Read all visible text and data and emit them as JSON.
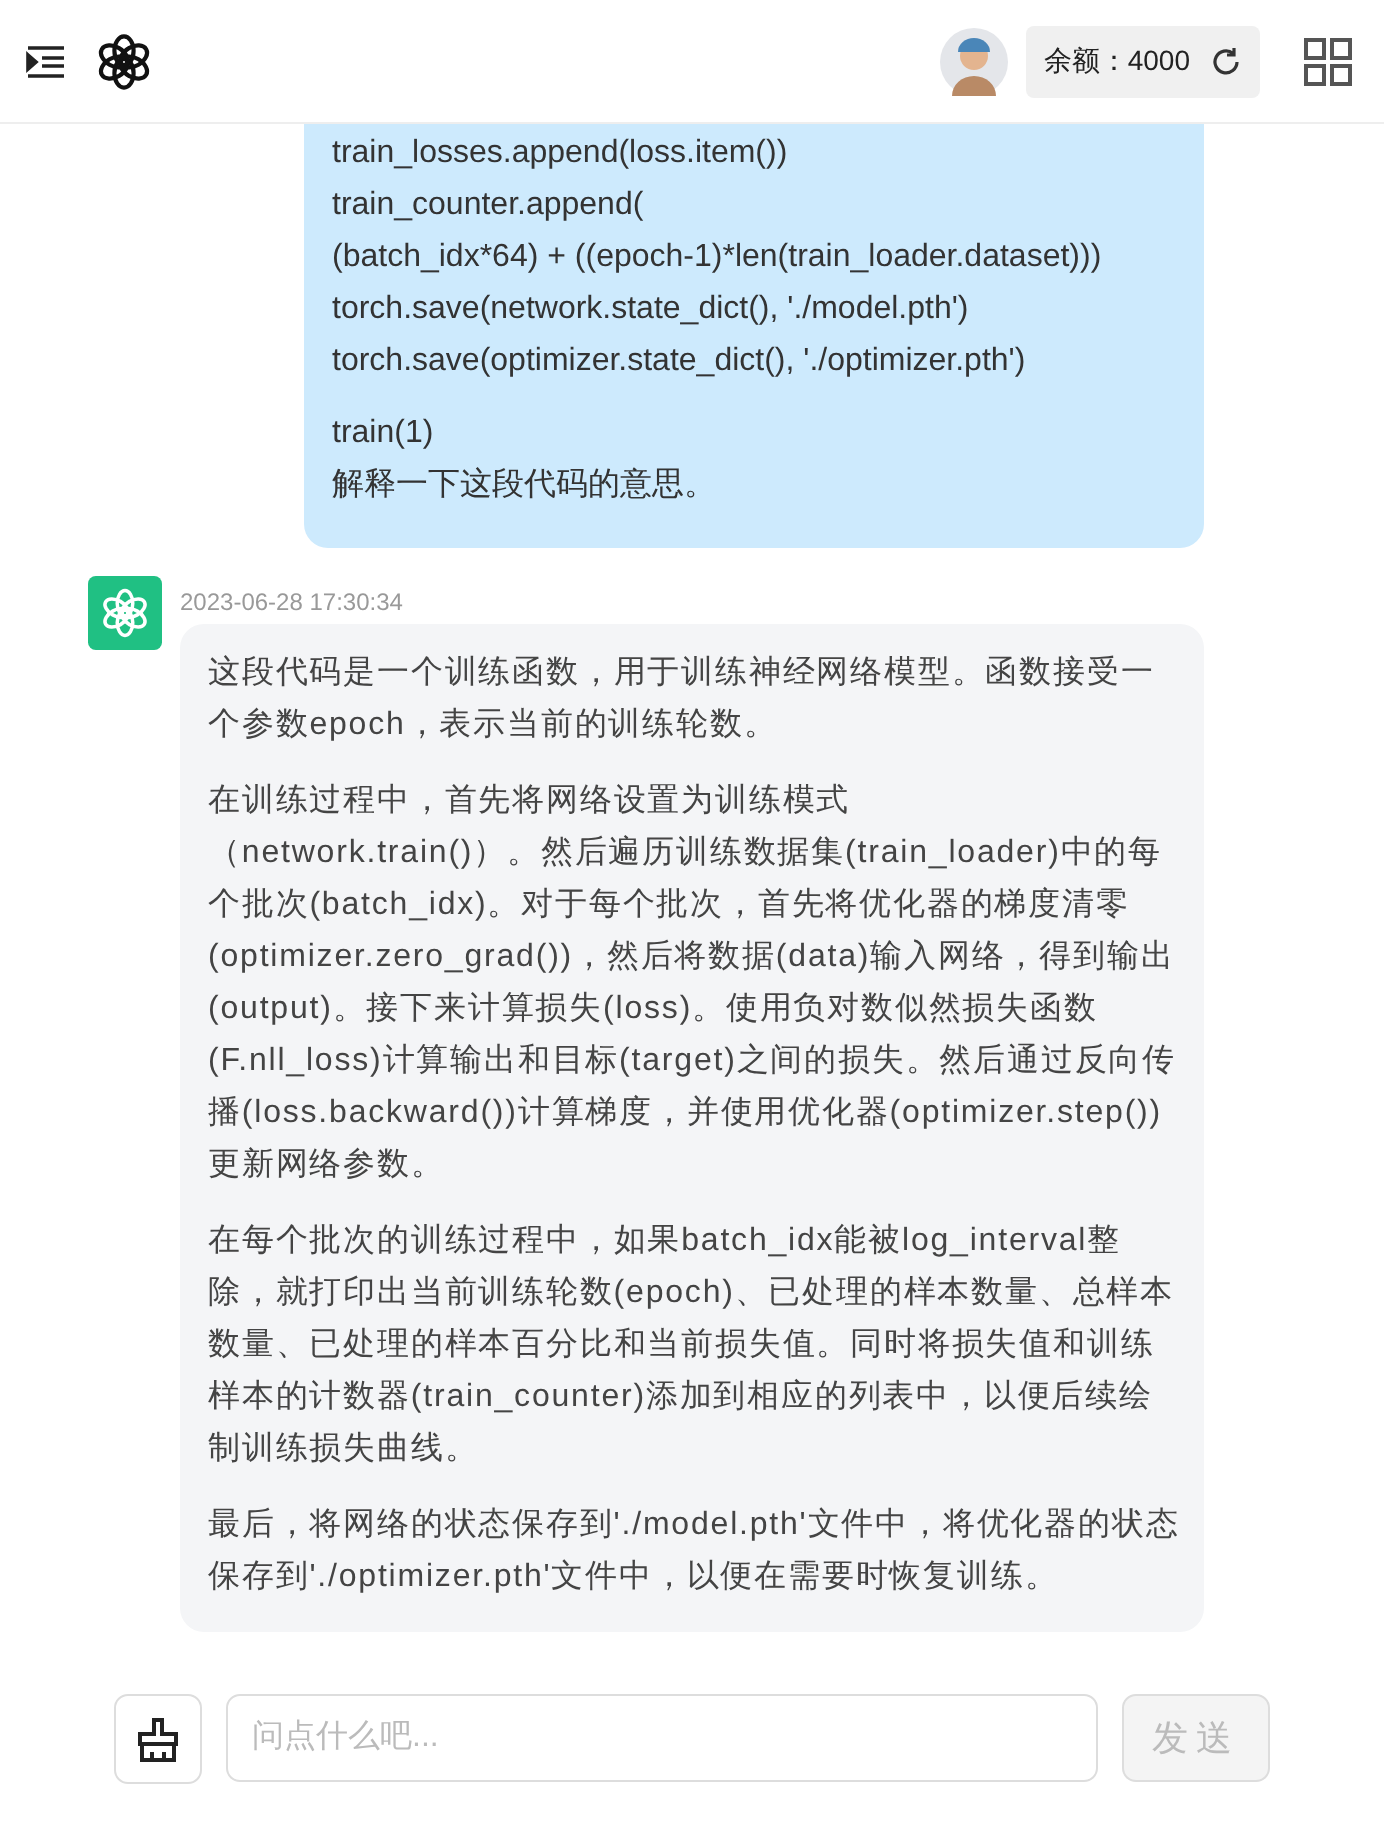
{
  "header": {
    "balance": "余额：4000"
  },
  "messages": [
    {
      "kind": "user",
      "paragraphs": [
        [
          "train_losses.append(loss.item())",
          "train_counter.append(",
          "(batch_idx*64) + ((epoch-1)*len(train_loader.dataset)))",
          "torch.save(network.state_dict(), './model.pth')",
          "torch.save(optimizer.state_dict(), './optimizer.pth')"
        ],
        [
          "train(1)",
          "解释一下这段代码的意思。"
        ]
      ]
    },
    {
      "kind": "assistant",
      "time": "2023-06-28 17:30:34",
      "paragraphs": [
        [
          "这段代码是一个训练函数，用于训练神经网络模型。函数接受一个参数epoch，表示当前的训练轮数。"
        ],
        [
          "在训练过程中，首先将网络设置为训练模式（network.train()）。然后遍历训练数据集(train_loader)中的每个批次(batch_idx)。对于每个批次，首先将优化器的梯度清零(optimizer.zero_grad())，然后将数据(data)输入网络，得到输出(output)。接下来计算损失(loss)。使用负对数似然损失函数(F.nll_loss)计算输出和目标(target)之间的损失。然后通过反向传播(loss.backward())计算梯度，并使用优化器(optimizer.step())更新网络参数。"
        ],
        [
          "在每个批次的训练过程中，如果batch_idx能被log_interval整除，就打印出当前训练轮数(epoch)、已处理的样本数量、总样本数量、已处理的样本百分比和当前损失值。同时将损失值和训练样本的计数器(train_counter)添加到相应的列表中，以便后续绘制训练损失曲线。"
        ],
        [
          "最后，将网络的状态保存到'./model.pth'文件中，将优化器的状态保存到'./optimizer.pth'文件中，以便在需要时恢复训练。"
        ]
      ]
    }
  ],
  "composer": {
    "placeholder": "问点什么吧...",
    "send": {
      "label": "发送",
      "disabled": true
    }
  }
}
